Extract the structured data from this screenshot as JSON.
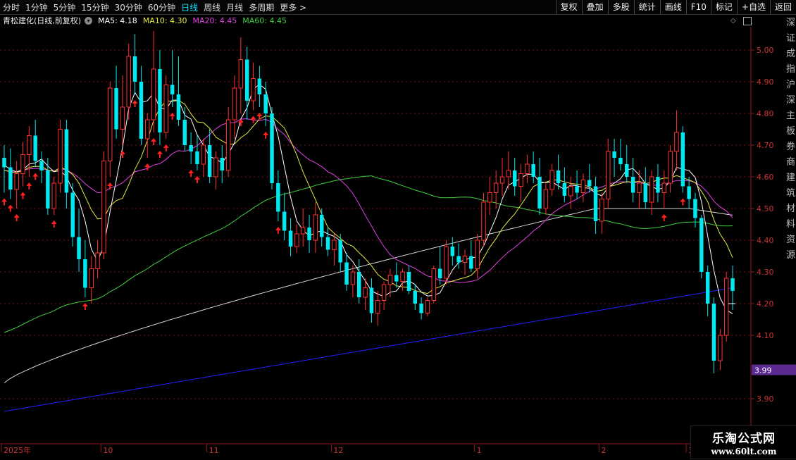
{
  "period_tabs": [
    {
      "label": "分时",
      "active": false
    },
    {
      "label": "1分钟",
      "active": false
    },
    {
      "label": "5分钟",
      "active": false
    },
    {
      "label": "15分钟",
      "active": false
    },
    {
      "label": "30分钟",
      "active": false
    },
    {
      "label": "60分钟",
      "active": false
    },
    {
      "label": "日线",
      "active": true
    },
    {
      "label": "周线",
      "active": false
    },
    {
      "label": "月线",
      "active": false
    },
    {
      "label": "多周期",
      "active": false
    },
    {
      "label": "更多 >",
      "active": false
    }
  ],
  "toolbar": [
    "复权",
    "叠加",
    "多股",
    "统计",
    "画线",
    "F10",
    "标记",
    "+自选",
    "返回"
  ],
  "info": {
    "title": "青松建化(日线,前复权)",
    "ma5": "MA5: 4.18",
    "ma10": "MA10: 4.30",
    "ma20": "MA20: 4.45",
    "ma60": "MA60: 4.45"
  },
  "colors": {
    "up": "#ff3030",
    "down": "#00e8f0",
    "ma5": "#ffffff",
    "ma10": "#e8e840",
    "ma20": "#e040e0",
    "ma60": "#40d040",
    "ma_long": "#d8d8d8",
    "ma_blue": "#2020ff",
    "arrow": "#ff2020",
    "grid": "#7a1010",
    "axis_text": "#cc3333"
  },
  "current_price_label": "3.99",
  "watermark": {
    "line1": "乐淘公式网",
    "line2": "www.60lt.com"
  },
  "right_panel_text": "深证成指沪深主板券商建筑材料资源",
  "chart_data": {
    "type": "candlestick",
    "y_ticks": [
      "5.00",
      "4.90",
      "4.80",
      "4.70",
      "4.60",
      "4.50",
      "4.40",
      "4.30",
      "4.20",
      "4.10",
      "3.90"
    ],
    "ylim": [
      3.84,
      5.15
    ],
    "x_labels": [
      {
        "label": "2025年",
        "index": 0
      },
      {
        "label": "10",
        "index": 16
      },
      {
        "label": "11",
        "index": 33
      },
      {
        "label": "12",
        "index": 53
      },
      {
        "label": "1",
        "index": 76
      },
      {
        "label": "2",
        "index": 96
      },
      {
        "label": "3",
        "index": 110
      }
    ],
    "candles": [
      [
        4.66,
        4.7,
        4.55,
        4.63
      ],
      [
        4.63,
        4.69,
        4.53,
        4.56
      ],
      [
        4.56,
        4.65,
        4.5,
        4.61
      ],
      [
        4.61,
        4.71,
        4.57,
        4.67
      ],
      [
        4.67,
        4.76,
        4.6,
        4.73
      ],
      [
        4.73,
        4.78,
        4.63,
        4.65
      ],
      [
        4.65,
        4.68,
        4.58,
        4.62
      ],
      [
        4.62,
        4.66,
        4.48,
        4.5
      ],
      [
        4.5,
        4.6,
        4.48,
        4.58
      ],
      [
        4.58,
        4.78,
        4.55,
        4.75
      ],
      [
        4.75,
        4.78,
        4.5,
        4.55
      ],
      [
        4.55,
        4.58,
        4.38,
        4.41
      ],
      [
        4.41,
        4.5,
        4.3,
        4.34
      ],
      [
        4.34,
        4.4,
        4.22,
        4.25
      ],
      [
        4.25,
        4.35,
        4.2,
        4.31
      ],
      [
        4.31,
        4.4,
        4.28,
        4.36
      ],
      [
        4.36,
        4.68,
        4.34,
        4.65
      ],
      [
        4.65,
        4.9,
        4.6,
        4.88
      ],
      [
        4.88,
        4.95,
        4.72,
        4.75
      ],
      [
        4.75,
        4.92,
        4.7,
        4.82
      ],
      [
        4.82,
        5.02,
        4.78,
        4.98
      ],
      [
        4.98,
        5.05,
        4.86,
        4.9
      ],
      [
        4.9,
        4.95,
        4.7,
        4.72
      ],
      [
        4.72,
        4.8,
        4.66,
        4.78
      ],
      [
        4.78,
        5.06,
        4.74,
        4.94
      ],
      [
        4.94,
        5.0,
        4.7,
        4.74
      ],
      [
        4.74,
        4.92,
        4.72,
        4.89
      ],
      [
        4.89,
        5.0,
        4.82,
        4.86
      ],
      [
        4.86,
        4.98,
        4.76,
        4.78
      ],
      [
        4.78,
        4.82,
        4.68,
        4.7
      ],
      [
        4.7,
        4.74,
        4.64,
        4.68
      ],
      [
        4.68,
        4.73,
        4.62,
        4.64
      ],
      [
        4.64,
        4.72,
        4.6,
        4.7
      ],
      [
        4.7,
        4.75,
        4.58,
        4.6
      ],
      [
        4.6,
        4.68,
        4.56,
        4.66
      ],
      [
        4.66,
        4.7,
        4.58,
        4.62
      ],
      [
        4.62,
        4.82,
        4.6,
        4.78
      ],
      [
        4.78,
        4.92,
        4.72,
        4.88
      ],
      [
        4.88,
        5.04,
        4.8,
        4.97
      ],
      [
        4.97,
        5.01,
        4.78,
        4.84
      ],
      [
        4.84,
        4.96,
        4.81,
        4.91
      ],
      [
        4.91,
        4.95,
        4.82,
        4.86
      ],
      [
        4.86,
        4.9,
        4.76,
        4.8
      ],
      [
        4.8,
        4.82,
        4.56,
        4.58
      ],
      [
        4.58,
        4.62,
        4.46,
        4.49
      ],
      [
        4.49,
        4.55,
        4.4,
        4.43
      ],
      [
        4.43,
        4.47,
        4.35,
        4.38
      ],
      [
        4.38,
        4.45,
        4.36,
        4.42
      ],
      [
        4.42,
        4.5,
        4.38,
        4.44
      ],
      [
        4.44,
        4.48,
        4.36,
        4.4
      ],
      [
        4.4,
        4.52,
        4.36,
        4.48
      ],
      [
        4.48,
        4.5,
        4.38,
        4.41
      ],
      [
        4.41,
        4.44,
        4.35,
        4.37
      ],
      [
        4.37,
        4.42,
        4.32,
        4.4
      ],
      [
        4.4,
        4.42,
        4.3,
        4.33
      ],
      [
        4.33,
        4.36,
        4.24,
        4.26
      ],
      [
        4.26,
        4.32,
        4.22,
        4.3
      ],
      [
        4.3,
        4.34,
        4.2,
        4.22
      ],
      [
        4.22,
        4.28,
        4.18,
        4.25
      ],
      [
        4.25,
        4.28,
        4.14,
        4.17
      ],
      [
        4.17,
        4.24,
        4.13,
        4.21
      ],
      [
        4.21,
        4.27,
        4.18,
        4.26
      ],
      [
        4.26,
        4.31,
        4.22,
        4.29
      ],
      [
        4.29,
        4.33,
        4.25,
        4.27
      ],
      [
        4.27,
        4.31,
        4.24,
        4.3
      ],
      [
        4.3,
        4.32,
        4.23,
        4.24
      ],
      [
        4.24,
        4.26,
        4.18,
        4.2
      ],
      [
        4.2,
        4.22,
        4.15,
        4.17
      ],
      [
        4.17,
        4.22,
        4.16,
        4.21
      ],
      [
        4.21,
        4.32,
        4.2,
        4.31
      ],
      [
        4.31,
        4.38,
        4.26,
        4.28
      ],
      [
        4.28,
        4.4,
        4.26,
        4.38
      ],
      [
        4.38,
        4.41,
        4.32,
        4.35
      ],
      [
        4.35,
        4.39,
        4.31,
        4.33
      ],
      [
        4.33,
        4.37,
        4.29,
        4.35
      ],
      [
        4.35,
        4.4,
        4.3,
        4.31
      ],
      [
        4.31,
        4.42,
        4.28,
        4.4
      ],
      [
        4.4,
        4.55,
        4.38,
        4.52
      ],
      [
        4.52,
        4.6,
        4.48,
        4.55
      ],
      [
        4.55,
        4.62,
        4.5,
        4.58
      ],
      [
        4.58,
        4.66,
        4.54,
        4.6
      ],
      [
        4.6,
        4.68,
        4.56,
        4.62
      ],
      [
        4.62,
        4.66,
        4.54,
        4.57
      ],
      [
        4.57,
        4.64,
        4.52,
        4.61
      ],
      [
        4.61,
        4.67,
        4.58,
        4.64
      ],
      [
        4.64,
        4.68,
        4.58,
        4.6
      ],
      [
        4.6,
        4.66,
        4.48,
        4.5
      ],
      [
        4.5,
        4.58,
        4.48,
        4.56
      ],
      [
        4.56,
        4.64,
        4.54,
        4.62
      ],
      [
        4.62,
        4.67,
        4.56,
        4.58
      ],
      [
        4.58,
        4.63,
        4.52,
        4.54
      ],
      [
        4.54,
        4.6,
        4.5,
        4.57
      ],
      [
        4.57,
        4.62,
        4.53,
        4.55
      ],
      [
        4.55,
        4.61,
        4.52,
        4.59
      ],
      [
        4.59,
        4.64,
        4.55,
        4.57
      ],
      [
        4.57,
        4.6,
        4.42,
        4.46
      ],
      [
        4.46,
        4.55,
        4.42,
        4.53
      ],
      [
        4.53,
        4.72,
        4.5,
        4.68
      ],
      [
        4.68,
        4.72,
        4.6,
        4.66
      ],
      [
        4.66,
        4.72,
        4.62,
        4.64
      ],
      [
        4.64,
        4.7,
        4.58,
        4.6
      ],
      [
        4.6,
        4.66,
        4.52,
        4.55
      ],
      [
        4.55,
        4.62,
        4.5,
        4.58
      ],
      [
        4.58,
        4.63,
        4.5,
        4.52
      ],
      [
        4.52,
        4.62,
        4.48,
        4.6
      ],
      [
        4.6,
        4.64,
        4.52,
        4.55
      ],
      [
        4.55,
        4.62,
        4.5,
        4.58
      ],
      [
        4.58,
        4.7,
        4.55,
        4.68
      ],
      [
        4.68,
        4.81,
        4.62,
        4.74
      ],
      [
        4.74,
        4.76,
        4.55,
        4.57
      ],
      [
        4.57,
        4.6,
        4.5,
        4.53
      ],
      [
        4.53,
        4.55,
        4.44,
        4.47
      ],
      [
        4.47,
        4.48,
        4.28,
        4.3
      ],
      [
        4.3,
        4.32,
        4.16,
        4.2
      ],
      [
        4.2,
        4.22,
        3.98,
        4.02
      ],
      [
        4.02,
        4.12,
        3.99,
        4.1
      ],
      [
        4.1,
        4.3,
        4.08,
        4.28
      ],
      [
        4.28,
        4.32,
        4.18,
        4.24
      ]
    ],
    "up_arrows": [
      0,
      1,
      2,
      3,
      4,
      5,
      8,
      13,
      17,
      19,
      21,
      23,
      24,
      25,
      26,
      27,
      30,
      31,
      38,
      40,
      41,
      42,
      44,
      106,
      109
    ]
  }
}
